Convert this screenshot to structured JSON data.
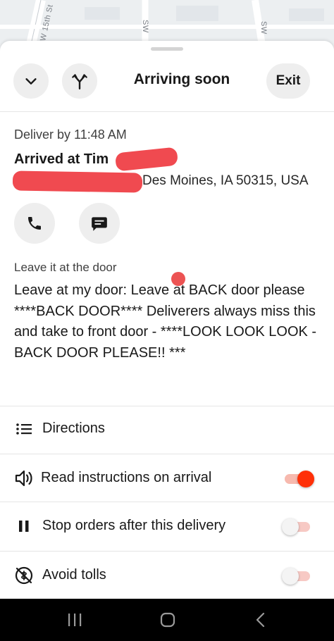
{
  "map": {
    "street_1": "W 15th St",
    "street_2": "SW",
    "street_3": "SW"
  },
  "header": {
    "title": "Arriving soon",
    "exit_label": "Exit",
    "collapse_icon": "chevron-down-icon",
    "route_icon": "route-split-icon"
  },
  "delivery": {
    "deliver_by": "Deliver by 11:48 AM",
    "store_name": "Arrived at Tim",
    "address_tail": "Des Moines, IA 50315, USA"
  },
  "contact": {
    "call_icon": "phone-icon",
    "message_icon": "message-icon"
  },
  "instructions": {
    "label": "Leave it at the door",
    "text": "Leave at my door: Leave at BACK door please  ****BACK DOOR**** Deliverers always miss this and take to front door - ****LOOK LOOK LOOK - BACK DOOR PLEASE!! ***"
  },
  "rows": {
    "directions": {
      "label": "Directions",
      "icon": "list-icon"
    },
    "read_instructions": {
      "label": "Read instructions on arrival",
      "icon": "speaker-icon",
      "enabled": true
    },
    "stop_orders": {
      "label": "Stop orders after this delivery",
      "icon": "pause-icon",
      "enabled": false
    },
    "avoid_tolls": {
      "label": "Avoid tolls",
      "icon": "toll-off-icon",
      "enabled": false
    }
  },
  "colors": {
    "accent": "#ff3008",
    "toggle_off_track": "#f7c9c4",
    "redaction": "#f04a50"
  }
}
